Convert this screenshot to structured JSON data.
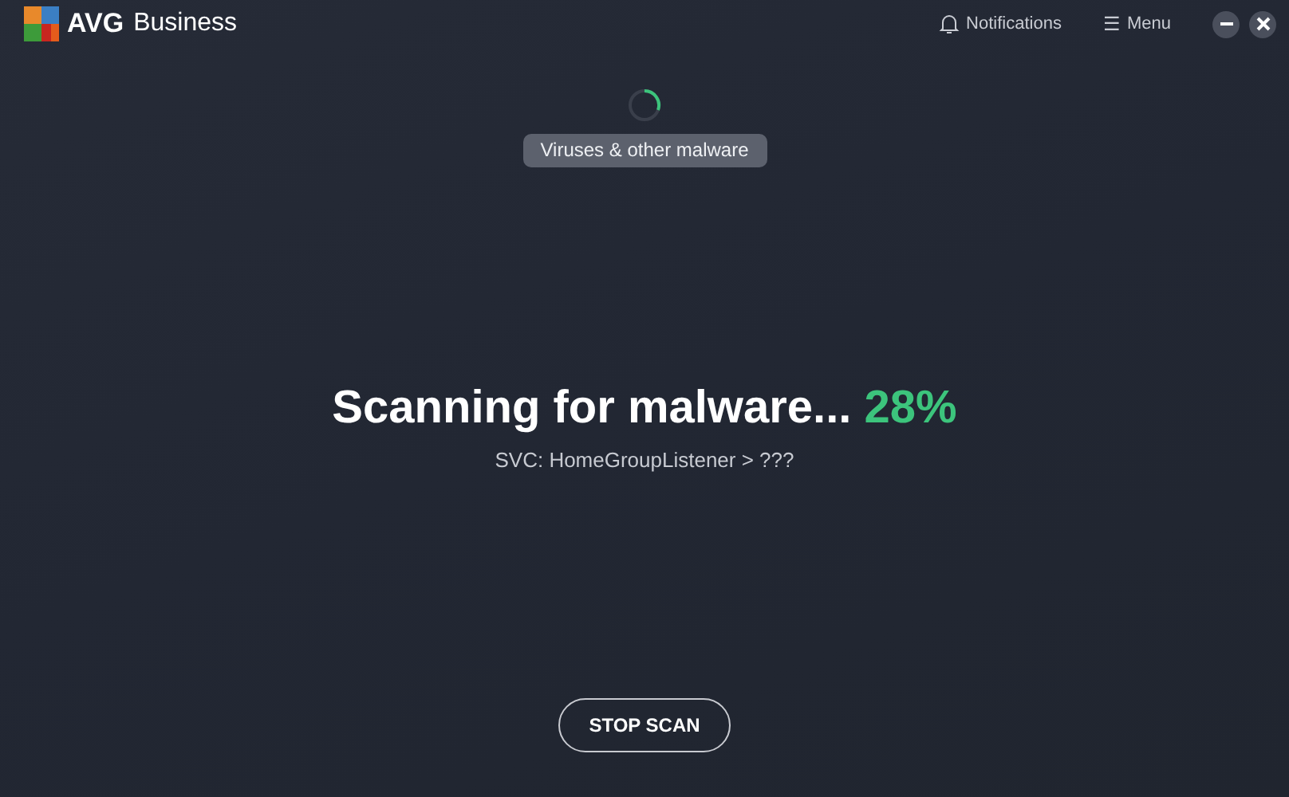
{
  "app": {
    "brand": "AVG",
    "product": "Business"
  },
  "header": {
    "notifications": "Notifications",
    "menu": "Menu",
    "menu_icon": "☰"
  },
  "scan": {
    "category": "Viruses & other malware",
    "title": "Scanning for malware...",
    "percent": "28%",
    "target": "SVC: HomeGroupListener > ???"
  },
  "buttons": [
    "STOP SCAN"
  ]
}
